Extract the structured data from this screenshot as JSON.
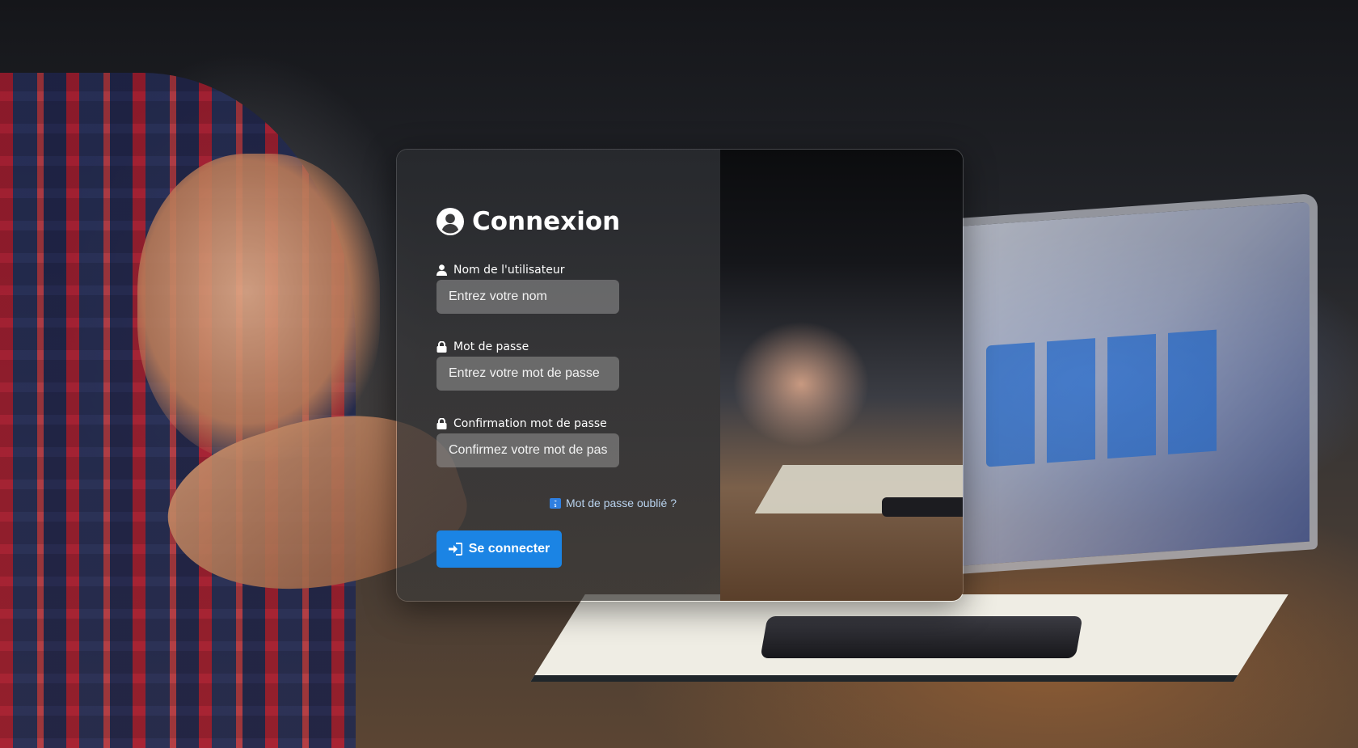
{
  "form": {
    "title": "Connexion",
    "username": {
      "label": "Nom de l'utilisateur",
      "placeholder": "Entrez votre nom",
      "value": ""
    },
    "password": {
      "label": "Mot de passe",
      "placeholder": "Entrez votre mot de passe",
      "value": ""
    },
    "confirm_password": {
      "label": "Confirmation mot de passe",
      "placeholder": "Confirmez votre mot de passe",
      "value": ""
    },
    "forgot_link": "Mot de passe oublié ?",
    "submit_label": "Se connecter"
  },
  "icons": {
    "title": "user-circle-icon",
    "username": "user-icon",
    "password": "lock-icon",
    "confirm_password": "lock-icon",
    "forgot": "soon-icon",
    "submit": "sign-in-icon"
  },
  "colors": {
    "primary_button": "#1b84e4",
    "link": "#b9d3ee",
    "card_panel": "#37373a",
    "input_background": "#969696"
  }
}
